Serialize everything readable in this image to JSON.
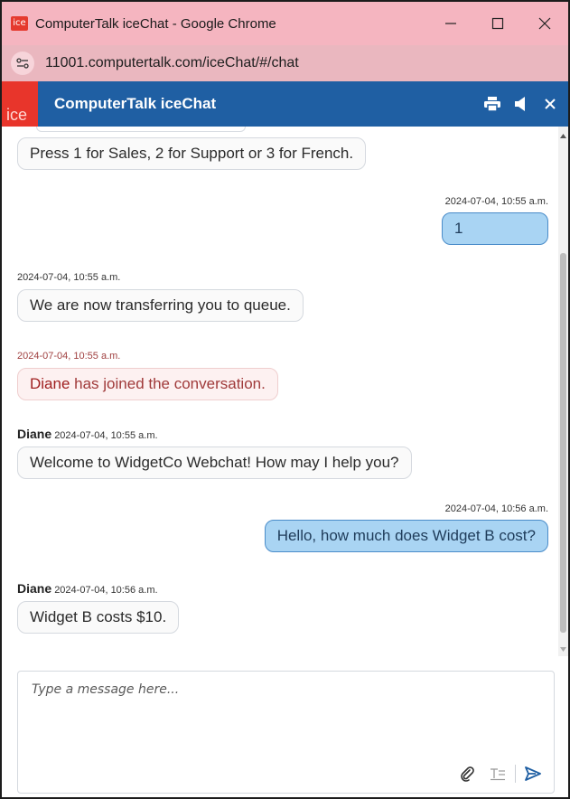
{
  "window": {
    "title": "ComputerTalk iceChat - Google Chrome",
    "app_icon_text": "ice"
  },
  "address": {
    "url": "11001.computertalk.com/iceChat/#/chat"
  },
  "header": {
    "logo_text": "ice",
    "title": "ComputerTalk iceChat"
  },
  "messages": [
    {
      "type": "in",
      "sender": "",
      "time": "",
      "text": "Press 1 for Sales, 2 for Support or 3 for French."
    },
    {
      "type": "out",
      "time": "2024-07-04, 10:55 a.m.",
      "text": "1"
    },
    {
      "type": "in",
      "sender": "",
      "time": "2024-07-04, 10:55 a.m.",
      "text": "We are now transferring you to queue."
    },
    {
      "type": "system",
      "time": "2024-07-04, 10:55 a.m.",
      "name": "Diane",
      "text": " has joined the conversation."
    },
    {
      "type": "in",
      "sender": "Diane",
      "time": "2024-07-04, 10:55 a.m.",
      "text": "Welcome to WidgetCo Webchat! How may I help you?"
    },
    {
      "type": "out",
      "time": "2024-07-04, 10:56 a.m.",
      "text": "Hello, how much does Widget B cost?"
    },
    {
      "type": "in",
      "sender": "Diane",
      "time": "2024-07-04, 10:56 a.m.",
      "text": "Widget B costs $10."
    }
  ],
  "compose": {
    "placeholder": "Type a message here..."
  }
}
